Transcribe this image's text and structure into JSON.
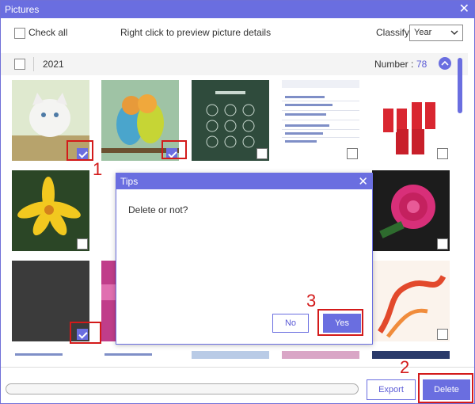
{
  "window": {
    "title": "Pictures"
  },
  "toolbar": {
    "check_all_label": "Check all",
    "hint": "Right click to preview picture details",
    "classify_label": "Classify:",
    "classify_value": "Year"
  },
  "group": {
    "year": "2021",
    "number_label": "Number :",
    "number_value": "78"
  },
  "dialog": {
    "title": "Tips",
    "message": "Delete or not?",
    "no_label": "No",
    "yes_label": "Yes"
  },
  "footer": {
    "export_label": "Export",
    "delete_label": "Delete"
  },
  "annotations": {
    "step1": "1",
    "step2": "2",
    "step3": "3"
  },
  "thumbnails": [
    {
      "subject": "white kitten",
      "checked": true
    },
    {
      "subject": "lovebirds",
      "checked": true
    },
    {
      "subject": "phone passcode screen",
      "checked": false
    },
    {
      "subject": "settings list screenshot",
      "checked": false
    },
    {
      "subject": "red gift boxes",
      "checked": false
    },
    {
      "subject": "yellow lily",
      "checked": false
    },
    {
      "subject": "pink rose",
      "checked": false
    },
    {
      "subject": "dark image",
      "checked": true
    },
    {
      "subject": "abstract smoke",
      "checked": false
    }
  ],
  "colors": {
    "accent": "#6a6ee0",
    "annotation": "#d31a1a"
  }
}
